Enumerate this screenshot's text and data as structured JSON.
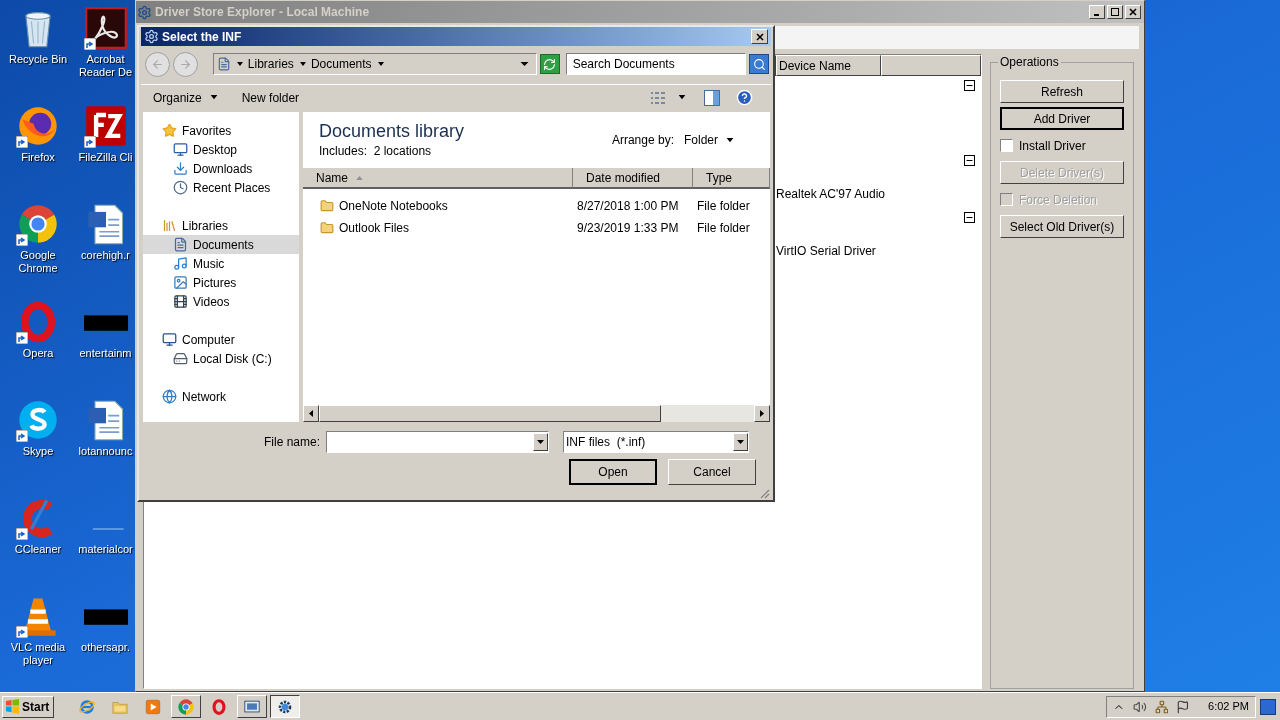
{
  "desktop_icons": [
    {
      "label": "Recycle Bin",
      "shortcut": false
    },
    {
      "label": "Acrobat Reader De",
      "shortcut": true
    },
    {
      "label": "Firefox",
      "shortcut": true
    },
    {
      "label": "FileZilla Cli",
      "shortcut": true
    },
    {
      "label": "Google Chrome",
      "shortcut": true
    },
    {
      "label": "corehigh.r",
      "shortcut": false
    },
    {
      "label": "Opera",
      "shortcut": true
    },
    {
      "label": "entertainm",
      "shortcut": false
    },
    {
      "label": "Skype",
      "shortcut": true
    },
    {
      "label": "lotannounc",
      "shortcut": false
    },
    {
      "label": "CCleaner",
      "shortcut": true
    },
    {
      "label": "materialcor",
      "shortcut": false
    },
    {
      "label": "VLC media player",
      "shortcut": true
    },
    {
      "label": "othersapr.",
      "shortcut": false
    }
  ],
  "main_window": {
    "title": "Driver Store Explorer - Local Machine",
    "columns": [
      "Device Name"
    ],
    "groups": [
      {
        "expanded": true
      },
      {
        "expanded": true,
        "devices": [
          "Realtek AC'97 Audio"
        ]
      },
      {
        "expanded": true,
        "devices": [
          "VirtIO Serial Driver"
        ]
      }
    ],
    "operations": {
      "title": "Operations",
      "items": [
        {
          "kind": "button",
          "label": "Refresh",
          "disabled": false,
          "focused": false
        },
        {
          "kind": "button",
          "label": "Add Driver",
          "disabled": false,
          "focused": true
        },
        {
          "kind": "checkbox",
          "label": "Install Driver",
          "disabled": false,
          "checked": false
        },
        {
          "kind": "button",
          "label": "Delete Driver(s)",
          "disabled": true,
          "focused": false
        },
        {
          "kind": "checkbox",
          "label": "Force Deletion",
          "disabled": true,
          "checked": false
        },
        {
          "kind": "button",
          "label": "Select Old Driver(s)",
          "disabled": false,
          "focused": false
        }
      ]
    }
  },
  "dialog": {
    "title": "Select the INF",
    "breadcrumb": [
      "Libraries",
      "Documents"
    ],
    "search": {
      "placeholder": "Search Documents"
    },
    "toolbar": [
      {
        "label": "Organize",
        "menu": true
      },
      {
        "label": "New folder",
        "menu": false
      }
    ],
    "nav": [
      {
        "label": "Favorites",
        "children": [
          {
            "label": "Desktop",
            "selected": false
          },
          {
            "label": "Downloads",
            "selected": false
          },
          {
            "label": "Recent Places",
            "selected": false
          }
        ]
      },
      {
        "label": "Libraries",
        "children": [
          {
            "label": "Documents",
            "selected": true
          },
          {
            "label": "Music",
            "selected": false
          },
          {
            "label": "Pictures",
            "selected": false
          },
          {
            "label": "Videos",
            "selected": false
          }
        ]
      },
      {
        "label": "Computer",
        "children": [
          {
            "label": "Local Disk (C:)",
            "selected": false
          }
        ]
      },
      {
        "label": "Network"
      }
    ],
    "library_title": "Documents library",
    "includes": "Includes:  2 locations",
    "arrange_label": "Arrange by:",
    "arrange_value": "Folder",
    "columns": [
      {
        "label": "Name",
        "sorted": true
      },
      {
        "label": "Date modified",
        "sorted": false
      },
      {
        "label": "Type",
        "sorted": false
      }
    ],
    "rows": [
      {
        "name": "OneNote Notebooks",
        "date": "8/27/2018 1:00 PM",
        "type": "File folder"
      },
      {
        "name": "Outlook Files",
        "date": "9/23/2019 1:33 PM",
        "type": "File folder"
      }
    ],
    "file_name_label": "File name:",
    "filter": "INF files  (*.inf)",
    "buttons": [
      {
        "label": "Open",
        "default": true
      },
      {
        "label": "Cancel",
        "default": false
      }
    ]
  },
  "taskbar": {
    "start": "Start",
    "items": [
      {
        "running": false,
        "selected": false
      },
      {
        "running": false,
        "selected": false
      },
      {
        "running": false,
        "selected": false
      },
      {
        "running": true,
        "selected": false
      },
      {
        "running": false,
        "selected": false
      },
      {
        "running": true,
        "selected": false
      },
      {
        "running": true,
        "selected": true
      }
    ],
    "time": "6:02 PM"
  }
}
